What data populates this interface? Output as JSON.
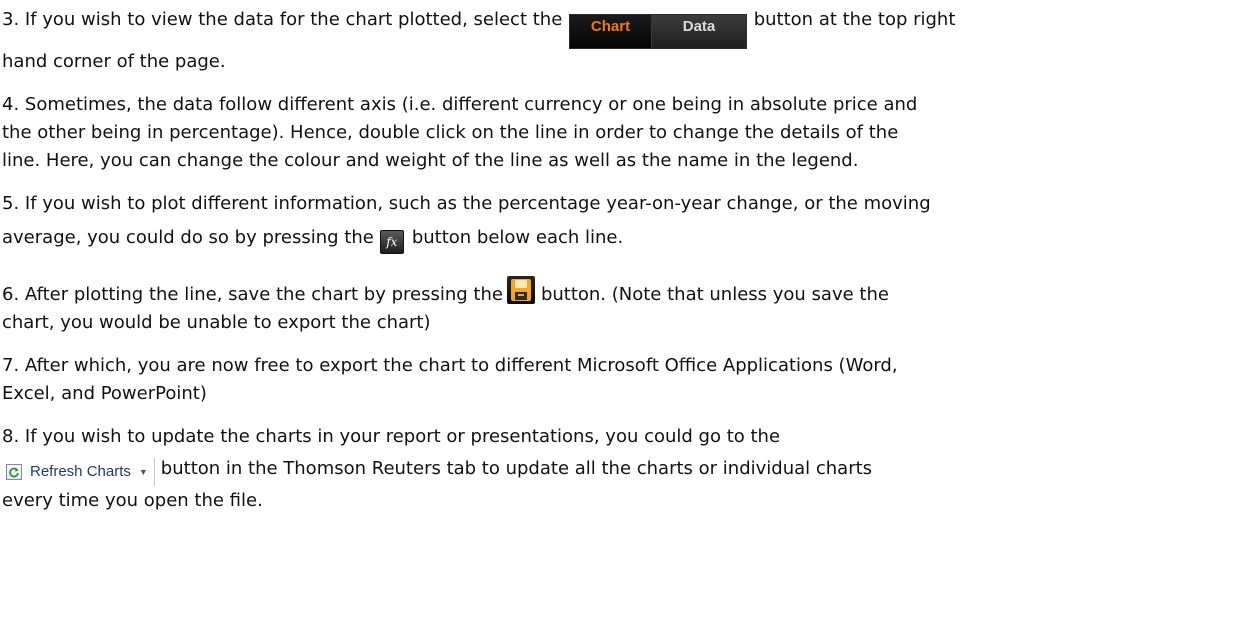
{
  "steps": [
    {
      "before": "3. If you wish to view the data for the chart plotted, select the ",
      "after": " button at the top right",
      "line2": "hand corner of the page."
    },
    {
      "line1": "4. Sometimes, the data follow different axis (i.e. different currency or one being in absolute price and",
      "line2": "the other being in percentage). Hence, double click on the line in order to change the details of the",
      "line3": "line. Here, you can change the colour and weight of the line as well as the name in the legend."
    },
    {
      "line1": "5. If you wish to plot different information, such as the percentage year-on-year change, or the moving",
      "before": "average, you could do so by pressing the",
      "after": "button below each line."
    },
    {
      "before": "6. After plotting the line, save the chart by pressing the",
      "after": "button. (Note that unless you save the",
      "line2": "chart, you would be unable to export the chart)"
    },
    {
      "line1": "7. After which, you are now free to export the chart to different Microsoft Office Applications (Word,",
      "line2": "Excel, and PowerPoint)"
    },
    {
      "line1": "8. If you wish to update the charts in your report or presentations, you could go to the",
      "after": "button in the Thomson Reuters tab to update all the charts or individual charts",
      "line3": "every time you open the file."
    }
  ],
  "buttons": {
    "chart_label": "Chart",
    "data_label": "Data",
    "fx_label": "fx",
    "refresh_label": "Refresh Charts",
    "refresh_caret": "▼"
  },
  "colors": {
    "chart_active": "#f07818",
    "save_icon": "#f5a623",
    "text": "#111111"
  },
  "icons": {
    "fx": "function-icon",
    "save": "save-icon",
    "refresh": "refresh-icon"
  }
}
